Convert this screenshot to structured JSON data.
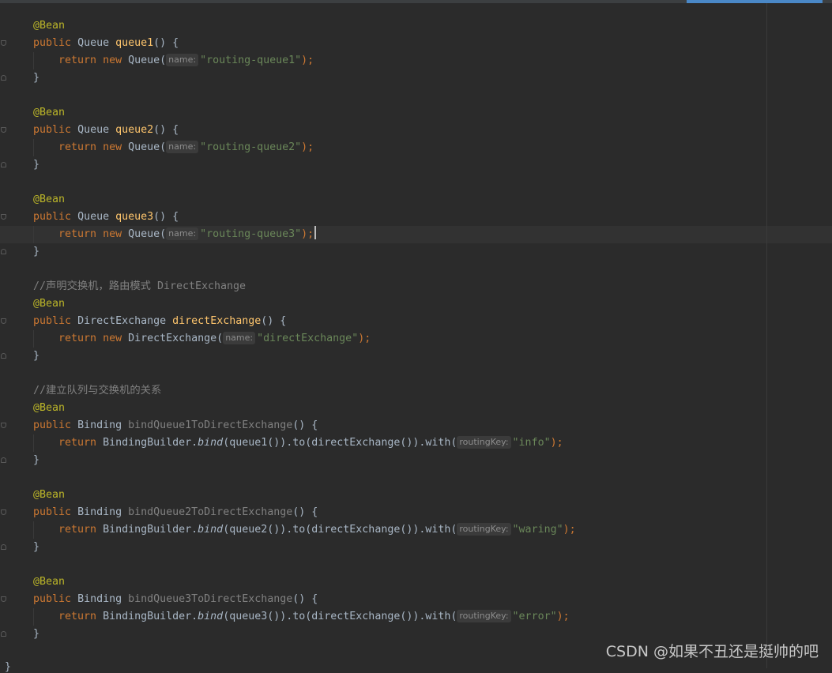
{
  "editor": {
    "watermark": "CSDN @如果不丑还是挺帅的吧",
    "closing_brace": "}",
    "hint_name": "name:",
    "hint_routing": "routingKey:",
    "annotation": "@Bean",
    "kw_public": "public",
    "kw_return": "return",
    "kw_new": "new",
    "close_brace": "}",
    "queue1": {
      "sig_type": "Queue ",
      "method": "queue1",
      "sig_tail": "() {",
      "ctor": "Queue(",
      "arg": "\"routing-queue1\"",
      "end": ");"
    },
    "queue2": {
      "sig_type": "Queue ",
      "method": "queue2",
      "sig_tail": "() {",
      "ctor": "Queue(",
      "arg": "\"routing-queue2\"",
      "end": ");"
    },
    "queue3": {
      "sig_type": "Queue ",
      "method": "queue3",
      "sig_tail": "() {",
      "ctor": "Queue(",
      "arg": "\"routing-queue3\"",
      "end": ");"
    },
    "exchange": {
      "comment": "//声明交换机，路由模式 DirectExchange",
      "sig_type": "DirectExchange ",
      "method": "directExchange",
      "sig_tail": "() {",
      "ctor": "DirectExchange(",
      "arg": "\"directExchange\"",
      "end": ");"
    },
    "bindings_comment": "//建立队列与交换机的关系",
    "binding1": {
      "sig_type": "Binding ",
      "method": "bindQueue1ToDirectExchange",
      "sig_tail": "() {",
      "builder": "BindingBuilder.",
      "bind": "bind",
      "chain": "(queue1()).to(directExchange()).with(",
      "arg": "\"info\"",
      "end": ");"
    },
    "binding2": {
      "sig_type": "Binding ",
      "method": "bindQueue2ToDirectExchange",
      "sig_tail": "() {",
      "builder": "BindingBuilder.",
      "bind": "bind",
      "chain": "(queue2()).to(directExchange()).with(",
      "arg": "\"waring\"",
      "end": ");"
    },
    "binding3": {
      "sig_type": "Binding ",
      "method": "bindQueue3ToDirectExchange",
      "sig_tail": "() {",
      "builder": "BindingBuilder.",
      "bind": "bind",
      "chain": "(queue3()).to(directExchange()).with(",
      "arg": "\"error\"",
      "end": ");"
    }
  }
}
